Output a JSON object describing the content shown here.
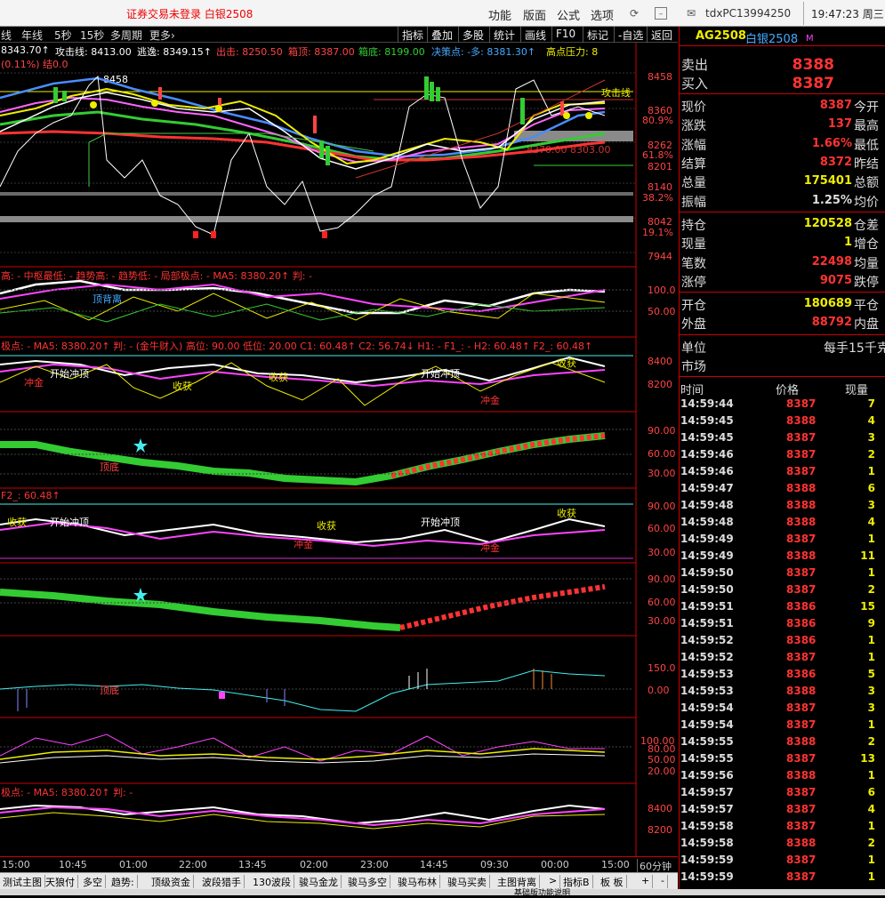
{
  "topbar": {
    "notice": "证券交易未登录 白银2508",
    "menus": [
      "功能",
      "版面",
      "公式",
      "选项"
    ],
    "pc_id": "tdxPC13994250",
    "clock": "19:47:23 周三"
  },
  "chart_toolbar": {
    "left": [
      "线",
      "年线",
      "5秒",
      "15秒",
      "多周期",
      "更多›"
    ],
    "right": [
      "指标",
      "叠加",
      "多股",
      "统计",
      "画线",
      "F10",
      "标记",
      "-自选",
      "返回"
    ]
  },
  "main_info": {
    "l1a": "8343.70↑",
    "l1b": "攻击线: 8413.00",
    "l1c": "逃逸: 8349.15↑",
    "l1d": "出击: 8250.50",
    "l1e": "箱顶: 8387.00",
    "l1f": "箱底: 8199.00",
    "l1g": "决策点: -多: 8381.30↑",
    "l1h": "高点压力: 8",
    "l2": "(0.11%) 结0.0",
    "peak": "8458",
    "attack": "攻击线",
    "mid_label": "8270.00  8303.00"
  },
  "price_axis": [
    "8458",
    "8360",
    "80.9%",
    "8262",
    "61.8%",
    "8201",
    "8140",
    "38.2%",
    "8042",
    "19.1%",
    "7944"
  ],
  "panel2": {
    "title": "高: - 中枢最低: - 趋势高: - 趋势低: - 局部极点: - MA5: 8380.20↑ 判: -",
    "axis": [
      "100.0",
      "50.00"
    ],
    "note": "顶背离"
  },
  "panel3": {
    "title": "极点: - MA5: 8380.20↑ 判: - (金牛财入) 高位: 90.00 低位: 20.00 C1: 60.48↑ C2: 56.74↓ H1: - F1_: - H2: 60.48↑ F2_: 60.48↑",
    "axis": [
      "8400",
      "8200"
    ],
    "tags": [
      "开始冲顶",
      "收获",
      "冲金",
      "开始冲顶",
      "收获",
      "冲金",
      "收获"
    ]
  },
  "panel4": {
    "axis": [
      "90.00",
      "60.00",
      "30.00"
    ],
    "note": "顶底"
  },
  "panel5": {
    "title": "F2_: 60.48↑",
    "axis": [
      "90.00",
      "60.00",
      "30.00"
    ],
    "tags": [
      "收获",
      "开始冲顶",
      "冲金",
      "收获",
      "开始冲顶",
      "冲金",
      "收获"
    ]
  },
  "panel6": {
    "axis": [
      "90.00",
      "60.00",
      "30.00"
    ]
  },
  "panel7": {
    "axis": [
      "150.0",
      "0.00"
    ],
    "note": "顶底"
  },
  "panel8": {
    "axis": [
      "100.00",
      "80.00",
      "50.00",
      "20.00"
    ]
  },
  "panel9": {
    "title": "极点: - MA5: 8380.20↑ 判: -",
    "axis": [
      "8400",
      "8200"
    ]
  },
  "xaxis": {
    "labels": [
      "15:00",
      "10:45",
      "01:00",
      "22:00",
      "13:45",
      "02:00",
      "23:00",
      "14:45",
      "09:30",
      "00:00",
      "15:00"
    ],
    "period": "60分钟"
  },
  "tabs": [
    "测试主图",
    "天狼付",
    "多空",
    "趋势:",
    "顶级资金",
    "波段猎手",
    "130波段",
    "骏马金龙",
    "骏马多空",
    "骏马布林",
    "骏马买卖",
    "主图背离",
    ">",
    "指标B",
    "板 板",
    "+",
    "-"
  ],
  "quote": {
    "code": "AG2508",
    "name": "白银2508",
    "sell_label": "卖出",
    "sell": "8388",
    "buy_label": "买入",
    "buy": "8387",
    "rows": [
      {
        "k": "现价",
        "v": "8387",
        "c": "#ff3333",
        "k2": "今开"
      },
      {
        "k": "涨跌",
        "v": "137",
        "c": "#ff3333",
        "k2": "最高"
      },
      {
        "k": "涨幅",
        "v": "1.66%",
        "c": "#ff3333",
        "k2": "最低"
      },
      {
        "k": "结算",
        "v": "8372",
        "c": "#ff3333",
        "k2": "昨结"
      },
      {
        "k": "总量",
        "v": "175401",
        "c": "#eeee00",
        "k2": "总额"
      },
      {
        "k": "振幅",
        "v": "1.25%",
        "c": "#dddddd",
        "k2": "均价"
      }
    ],
    "rows2": [
      {
        "k": "持仓",
        "v": "120528",
        "c": "#eeee00",
        "k2": "仓差"
      },
      {
        "k": "现量",
        "v": "1",
        "c": "#eeee00",
        "k2": "增仓"
      },
      {
        "k": "笔数",
        "v": "22498",
        "c": "#ff3333",
        "k2": "均量"
      },
      {
        "k": "涨停",
        "v": "9075",
        "c": "#ff3333",
        "k2": "跌停"
      }
    ],
    "rows3": [
      {
        "k": "开仓",
        "v": "180689",
        "c": "#eeee00",
        "k2": "平仓"
      },
      {
        "k": "外盘",
        "v": "88792",
        "c": "#ff3333",
        "k2": "内盘"
      }
    ],
    "unit_label": "单位",
    "unit_value": "每手15千克",
    "market_label": "市场"
  },
  "ticks": {
    "headers": [
      "时间",
      "价格",
      "现量"
    ],
    "rows": [
      [
        "14:59:44",
        "8387",
        "7"
      ],
      [
        "14:59:45",
        "8388",
        "4"
      ],
      [
        "14:59:45",
        "8387",
        "3"
      ],
      [
        "14:59:46",
        "8387",
        "2"
      ],
      [
        "14:59:46",
        "8387",
        "1"
      ],
      [
        "14:59:47",
        "8388",
        "6"
      ],
      [
        "14:59:48",
        "8388",
        "3"
      ],
      [
        "14:59:48",
        "8388",
        "4"
      ],
      [
        "14:59:49",
        "8387",
        "1"
      ],
      [
        "14:59:49",
        "8388",
        "11"
      ],
      [
        "14:59:50",
        "8387",
        "1"
      ],
      [
        "14:59:50",
        "8387",
        "2"
      ],
      [
        "14:59:51",
        "8386",
        "15"
      ],
      [
        "14:59:51",
        "8386",
        "9"
      ],
      [
        "14:59:52",
        "8386",
        "1"
      ],
      [
        "14:59:52",
        "8387",
        "1"
      ],
      [
        "14:59:53",
        "8386",
        "5"
      ],
      [
        "14:59:53",
        "8388",
        "3"
      ],
      [
        "14:59:54",
        "8387",
        "3"
      ],
      [
        "14:59:54",
        "8387",
        "1"
      ],
      [
        "14:59:55",
        "8388",
        "2"
      ],
      [
        "14:59:55",
        "8387",
        "13"
      ],
      [
        "14:59:56",
        "8388",
        "1"
      ],
      [
        "14:59:57",
        "8387",
        "6"
      ],
      [
        "14:59:57",
        "8387",
        "4"
      ],
      [
        "14:59:58",
        "8387",
        "1"
      ],
      [
        "14:59:58",
        "8388",
        "2"
      ],
      [
        "14:59:59",
        "8387",
        "1"
      ],
      [
        "14:59:59",
        "8387",
        "1"
      ]
    ]
  },
  "bottom_text": "基础版功能说明"
}
